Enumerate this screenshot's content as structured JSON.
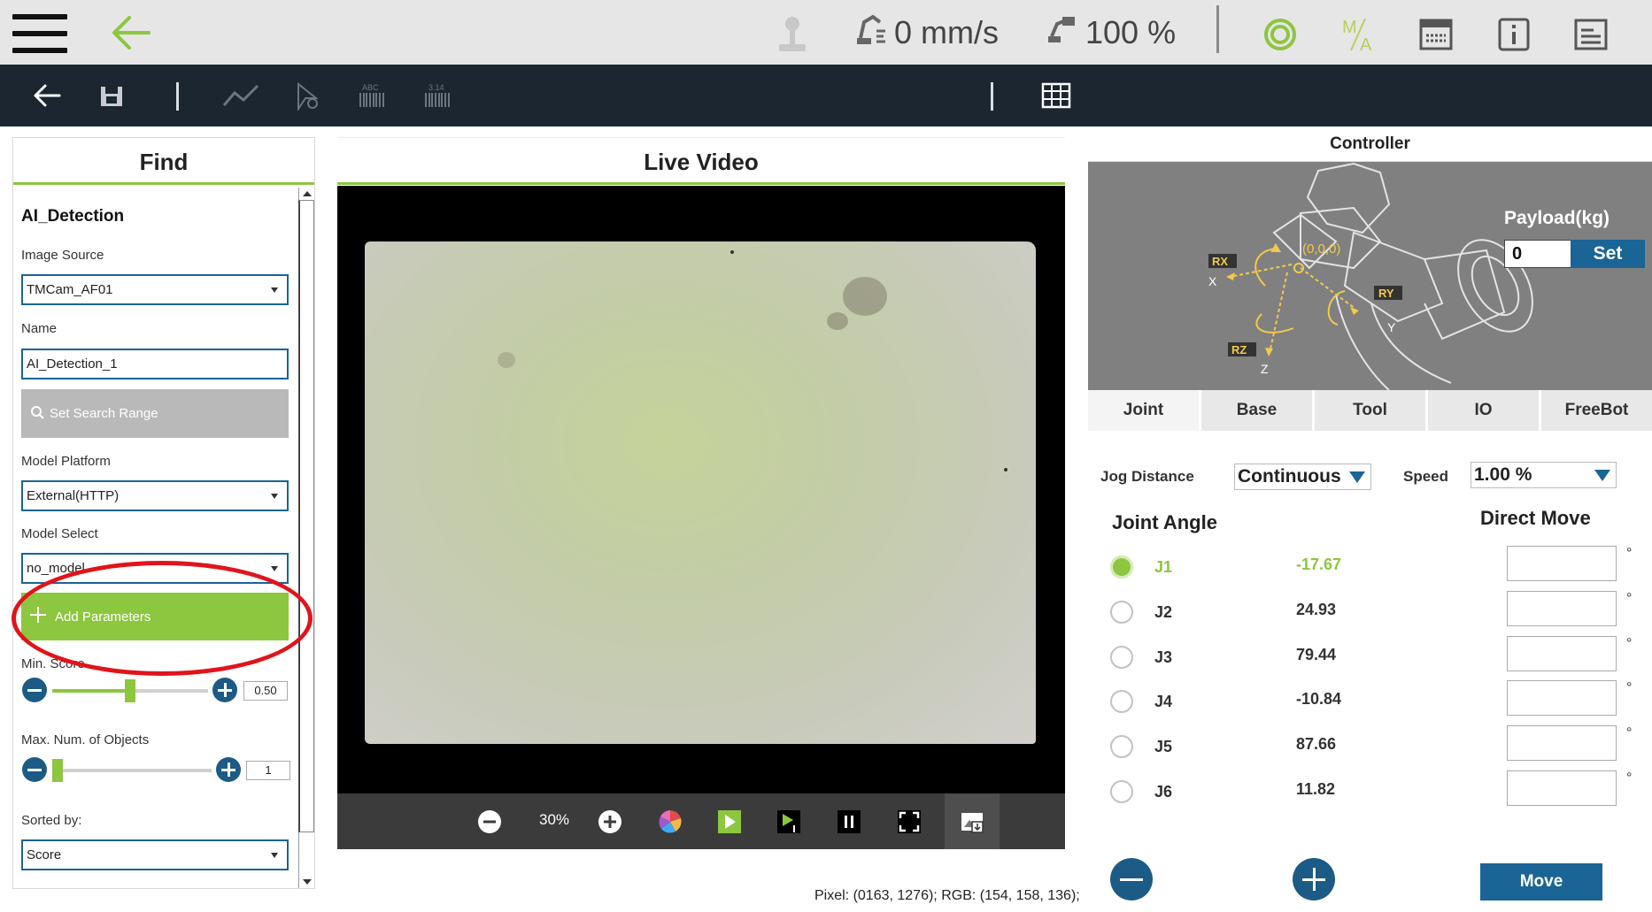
{
  "topbar": {
    "speed": "0 mm/s",
    "speed_percent": "100 %",
    "icons": [
      "menu-icon",
      "back-arrow-icon",
      "free-jog-icon",
      "robot-speed-icon",
      "speed-percent-icon",
      "status-ring-icon",
      "manual-auto-icon",
      "keyboard-icon",
      "info-icon",
      "log-icon"
    ],
    "ma_label_m": "M",
    "ma_label_a": "A"
  },
  "toolbar": {
    "icons": [
      "back-icon",
      "save-icon",
      "chart-icon",
      "point-icon",
      "barcode-icon",
      "ocr-icon",
      "table-icon"
    ],
    "barcode_text": "ABC",
    "ocr_text": "3.14"
  },
  "find": {
    "title": "Find",
    "section_title": "AI_Detection",
    "image_source_label": "Image Source",
    "image_source_value": "TMCam_AF01",
    "name_label": "Name",
    "name_value": "AI_Detection_1",
    "set_search_range": "Set Search Range",
    "model_platform_label": "Model Platform",
    "model_platform_value": "External(HTTP)",
    "model_select_label": "Model Select",
    "model_select_value": "no_model",
    "add_parameters": "Add Parameters",
    "min_score_label": "Min. Score",
    "min_score_value": "0.50",
    "min_score_fraction": 0.5,
    "max_objects_label": "Max. Num. of Objects",
    "max_objects_value": "1",
    "max_objects_fraction": 0.02,
    "sorted_by_label": "Sorted by:",
    "sorted_by_value": "Score"
  },
  "video": {
    "title": "Live Video",
    "zoom": "30%",
    "controls": [
      "zoom-out-icon",
      "zoom-in-icon",
      "color-wheel-icon",
      "play-icon",
      "step-play-icon",
      "pause-icon",
      "fullscreen-icon",
      "save-image-icon"
    ]
  },
  "pixel_info": "Pixel: (0163, 1276); RGB: (154, 158, 136);",
  "controller": {
    "title": "Controller",
    "payload_label": "Payload(kg)",
    "payload_value": "0",
    "set_label": "Set",
    "axes": {
      "rx": "RX",
      "ry": "RY",
      "rz": "RZ",
      "x": "X",
      "y": "Y",
      "z": "Z",
      "origin": "(0,0,0)"
    },
    "tabs": [
      "Joint",
      "Base",
      "Tool",
      "IO",
      "FreeBot"
    ],
    "active_tab": "Joint",
    "jog_distance_label": "Jog Distance",
    "jog_distance_value": "Continuous",
    "speed_label": "Speed",
    "speed_value": "1.00 %",
    "joint_angle_heading": "Joint Angle",
    "direct_move_heading": "Direct Move",
    "joints": [
      {
        "name": "J1",
        "value": "-17.67",
        "selected": true
      },
      {
        "name": "J2",
        "value": "24.93",
        "selected": false
      },
      {
        "name": "J3",
        "value": "79.44",
        "selected": false
      },
      {
        "name": "J4",
        "value": "-10.84",
        "selected": false
      },
      {
        "name": "J5",
        "value": "87.66",
        "selected": false
      },
      {
        "name": "J6",
        "value": "11.82",
        "selected": false
      }
    ],
    "degree_symbol": "°",
    "move_label": "Move"
  }
}
